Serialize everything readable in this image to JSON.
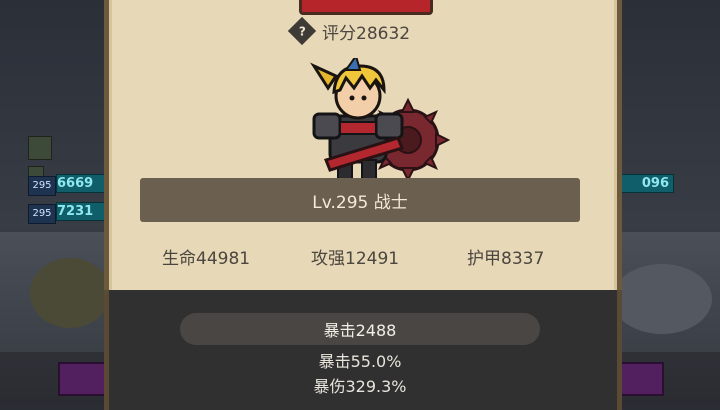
{
  "panel": {
    "score_text": "评分28632",
    "level_text": "Lv.295 战士"
  },
  "stats": {
    "hp": "生命44981",
    "attack": "攻强12491",
    "armor": "护甲8337"
  },
  "lower": {
    "crit_value": "暴击2488",
    "crit_rate": "暴击55.0%",
    "crit_damage": "暴伤329.3%"
  },
  "background": {
    "left_badges": [
      "295",
      "295"
    ],
    "left_hp": [
      "6669",
      "7231"
    ],
    "right_hp": [
      "096"
    ]
  },
  "colors": {
    "panel_bg": "#e7d8b7",
    "panel_border": "#6d5a3c",
    "level_bar": "#6b5f4f",
    "top_button": "#b5252a"
  }
}
